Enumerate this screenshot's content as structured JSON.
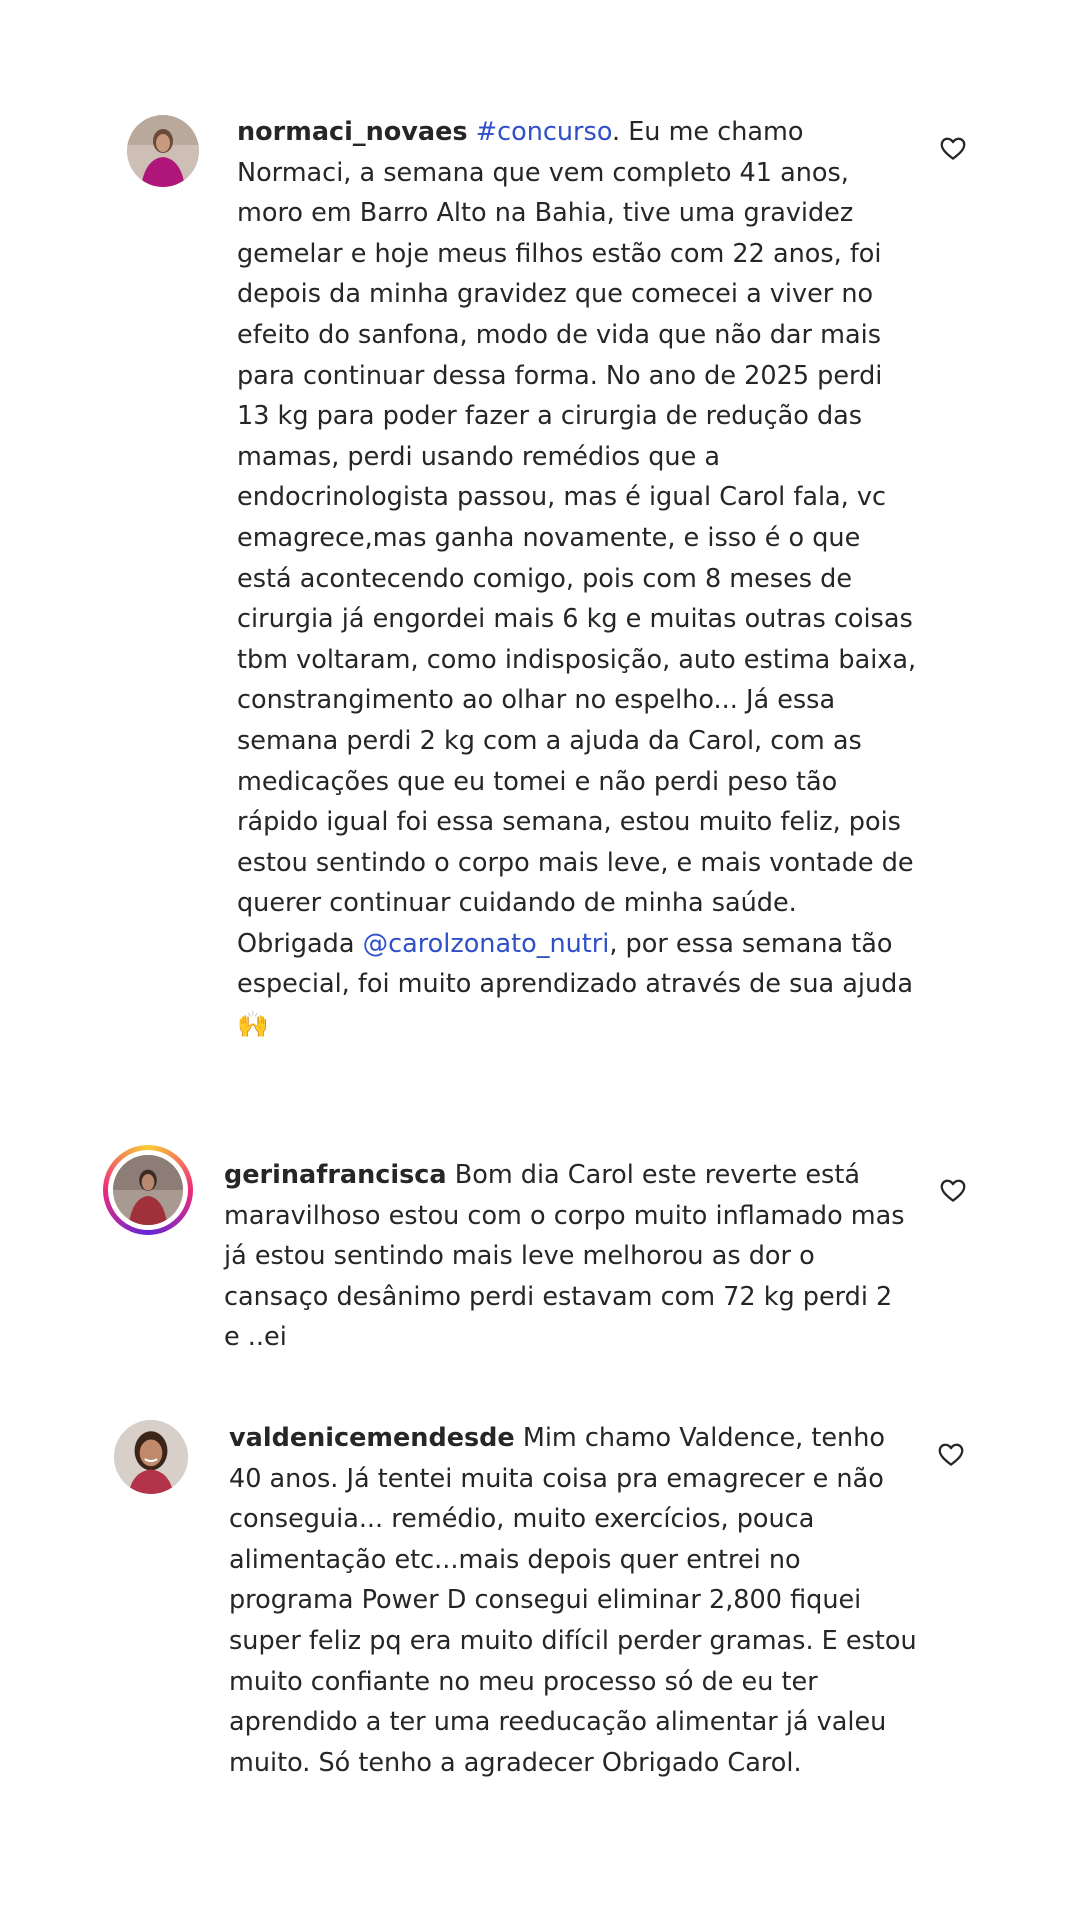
{
  "comments": [
    {
      "username": "normaci_novaes",
      "hashtag": "#concurso",
      "text_a": ". Eu me chamo Normaci, a semana que vem completo 41 anos, moro em Barro Alto na Bahia, tive uma gravidez gemelar e hoje meus filhos estão com 22 anos, foi depois da minha gravidez que comecei a viver no efeito do sanfona, modo de vida que não dar mais para continuar dessa forma. No ano de 2025 perdi 13 kg para poder fazer a cirurgia de redução das mamas, perdi usando remédios que a endocrinologista passou, mas é igual Carol fala, vc emagrece,mas ganha novamente, e isso é o que está acontecendo comigo, pois com 8 meses de cirurgia já engordei mais 6 kg e muitas outras coisas tbm voltaram, como indisposição, auto estima baixa, constrangimento ao olhar no espelho... Já essa semana perdi 2 kg com a ajuda da Carol, com as medicações que eu tomei e não perdi peso tão rápido igual foi essa semana, estou muito feliz, pois estou sentindo o corpo mais leve, e mais vontade de querer continuar cuidando de minha saúde. Obrigada ",
      "mention": "@carolzonato_nutri",
      "text_b": ", por essa semana tão especial, foi muito aprendizado através de sua ajuda ",
      "emoji": "🙌",
      "icons": {
        "avatar": "avatar-photo",
        "like": "heart-outline-icon"
      }
    },
    {
      "username": "gerinafrancisca",
      "text": " Bom dia Carol este reverte está maravilhoso estou com o corpo muito inflamado mas já estou sentindo mais leve melhorou as dor o cansaço desânimo perdi estavam com 72 kg perdi 2 e ..ei",
      "icons": {
        "avatar": "avatar-photo-story-ring",
        "like": "heart-outline-icon"
      }
    },
    {
      "username": "valdenicemendesde",
      "text": " Mim chamo Valdence, tenho 40 anos. Já tentei muita coisa pra emagrecer e não conseguia... remédio, muito exercícios, pouca alimentação etc...mais depois quer entrei no programa Power D consegui eliminar 2,800 fiquei super feliz pq era muito difícil perder gramas. E estou muito confiante no meu processo só de eu ter aprendido a ter uma reeducação alimentar já valeu muito. Só tenho a agradecer Obrigado Carol.",
      "icons": {
        "avatar": "avatar-photo",
        "like": "heart-outline-icon"
      }
    }
  ],
  "colors": {
    "text": "#262626",
    "link": "#3050c8",
    "story_ring": [
      "#f9ce34",
      "#ee2a7b",
      "#6228d7"
    ]
  }
}
